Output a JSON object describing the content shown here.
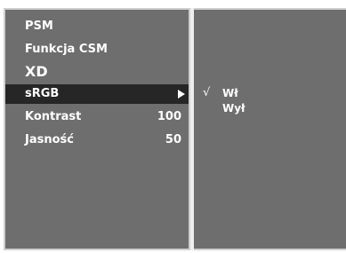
{
  "menu": {
    "items": [
      {
        "label": "PSM"
      },
      {
        "label": "Funkcja CSM"
      },
      {
        "label": "XD",
        "icon": "xd-logo"
      },
      {
        "label": "sRGB",
        "selected": true,
        "icon": "right-arrow-icon"
      },
      {
        "label": "Kontrast",
        "value": "100"
      },
      {
        "label": "Jasność",
        "value": "50"
      }
    ]
  },
  "submenu": {
    "check": "√",
    "options": [
      {
        "label": "Wł",
        "checked": true
      },
      {
        "label": "Wył",
        "checked": false
      }
    ]
  },
  "colors": {
    "panel": "#6e6e6e",
    "selected": "#262626",
    "text": "#ffffff",
    "border": "#cfcfcf"
  }
}
